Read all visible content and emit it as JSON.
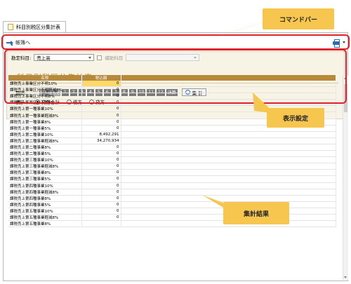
{
  "tab": {
    "label": "科目別税区分集計表"
  },
  "toolbar": {
    "back_label": "帳簿へ"
  },
  "settings": {
    "account_label": "勘定科目:",
    "account_value": "売上高",
    "sub_account_label": "補助科目",
    "report_title": "科目別税区分集計表",
    "period_label": "期間:",
    "period_buttons": [
      "当期 1年",
      "1",
      "2",
      "3",
      "4",
      "5",
      "6",
      "7",
      "8",
      "9",
      "10",
      "11",
      "12",
      "決算"
    ],
    "calc_button": "集 計",
    "display_label": "表示:",
    "display_options": [
      "貸借合計",
      "借方",
      "貸方"
    ],
    "display_selected": "貸借合計"
  },
  "table": {
    "columns": [
      "名称",
      "税込額"
    ],
    "rows": [
      {
        "name": "課税売上事業区分不明10%",
        "value": "0",
        "highlight": true
      },
      {
        "name": "課税売上事業区分不明軽減8%",
        "value": "0"
      },
      {
        "name": "課税売上事業区分不明8%",
        "value": "0"
      },
      {
        "name": "課税売上事業区分不明5%",
        "value": "0"
      },
      {
        "name": "課税売上第一種事業10%",
        "value": "0"
      },
      {
        "name": "課税売上第一種事業軽減8%",
        "value": "0"
      },
      {
        "name": "課税売上第一種事業8%",
        "value": "0"
      },
      {
        "name": "課税売上第一種事業5%",
        "value": "0"
      },
      {
        "name": "課税売上第二種事業10%",
        "value": "8,492,291"
      },
      {
        "name": "課税売上第二種事業軽減8%",
        "value": "34,270,934"
      },
      {
        "name": "課税売上第二種事業8%",
        "value": "0"
      },
      {
        "name": "課税売上第二種事業5%",
        "value": "0"
      },
      {
        "name": "課税売上第三種事業10%",
        "value": "0"
      },
      {
        "name": "課税売上第三種事業軽減8%",
        "value": "0"
      },
      {
        "name": "課税売上第三種事業8%",
        "value": "0"
      },
      {
        "name": "課税売上第三種事業5%",
        "value": "0"
      },
      {
        "name": "課税売上第四種事業10%",
        "value": "0"
      },
      {
        "name": "課税売上第四種事業軽減8%",
        "value": "0"
      },
      {
        "name": "課税売上第四種事業8%",
        "value": "0"
      },
      {
        "name": "課税売上第四種事業5%",
        "value": "0"
      },
      {
        "name": "課税売上第五種事業10%",
        "value": "0"
      },
      {
        "name": "課税売上第五種事業軽減8%",
        "value": "0"
      },
      {
        "name": "課税売上第五種事業8%",
        "value": ""
      }
    ]
  },
  "callouts": {
    "command_bar": "コマンドバー",
    "display_settings": "表示設定",
    "aggregate_results": "集計結果"
  },
  "colors": {
    "accent": "#b7893a",
    "highlight": "#ffd96b",
    "callout": "#f6c64f",
    "frame_red": "#e0202a",
    "title": "#b18a2f"
  }
}
